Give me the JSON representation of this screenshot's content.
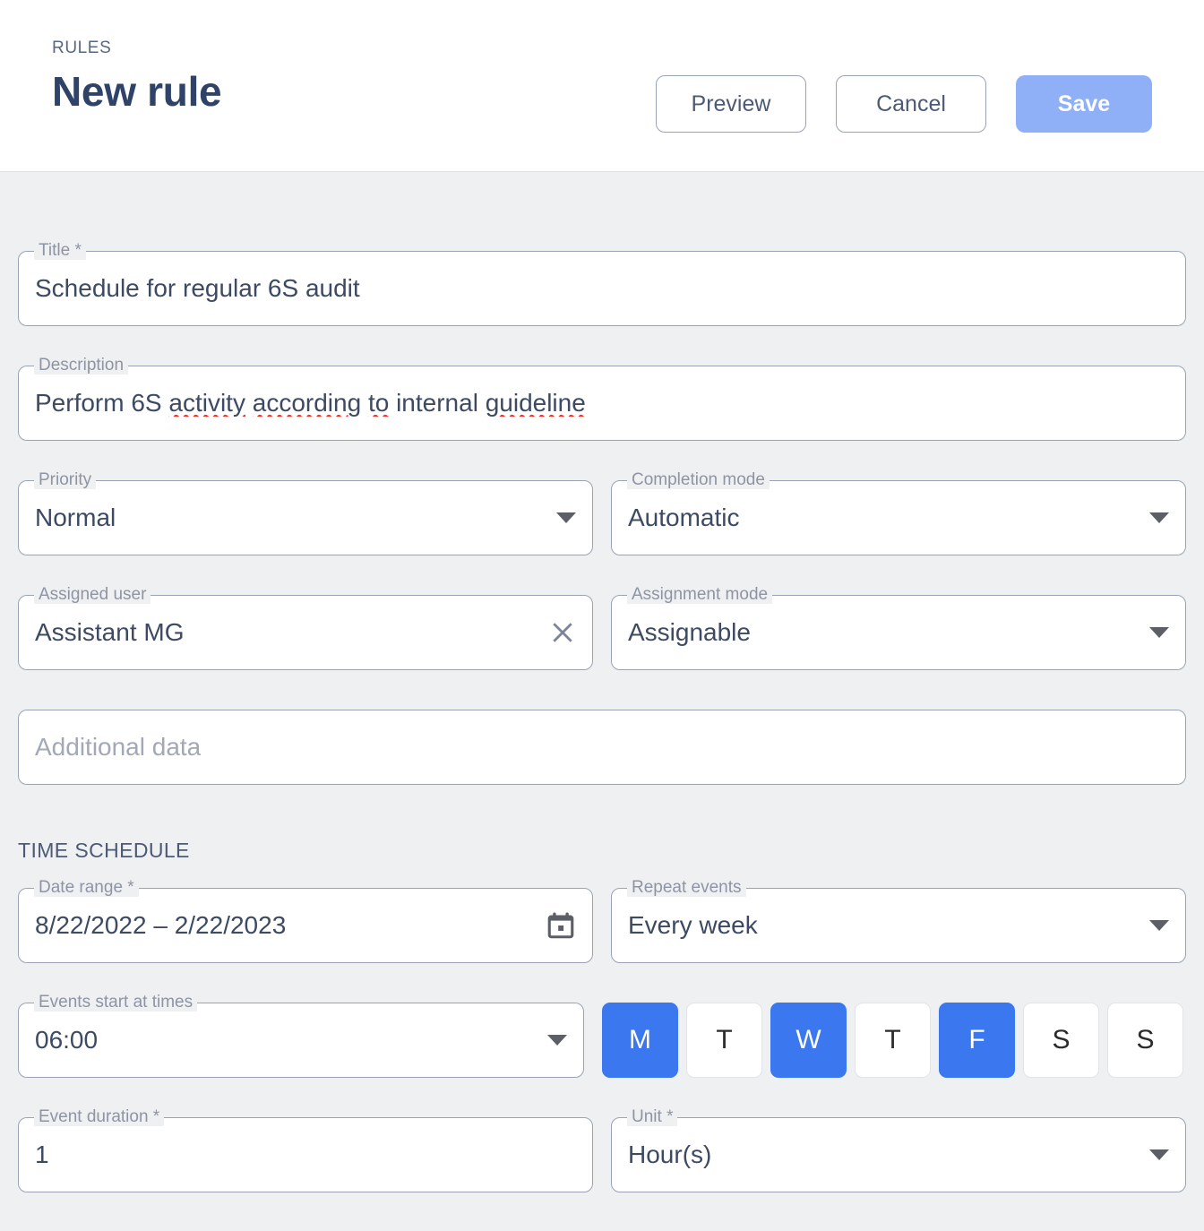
{
  "header": {
    "eyebrow": "RULES",
    "title": "New rule",
    "preview_label": "Preview",
    "cancel_label": "Cancel",
    "save_label": "Save",
    "save_bg": "#8fb0f7"
  },
  "form": {
    "title": {
      "label": "Title *",
      "value": "Schedule for regular 6S audit"
    },
    "description": {
      "label": "Description",
      "value": "Perform 6S activity according to internal guideline",
      "parts": [
        {
          "text": "Perform 6S ",
          "misspelled": false
        },
        {
          "text": "activity",
          "misspelled": true
        },
        {
          "text": " ",
          "misspelled": false
        },
        {
          "text": "according",
          "misspelled": true
        },
        {
          "text": " ",
          "misspelled": false
        },
        {
          "text": "to",
          "misspelled": true
        },
        {
          "text": " internal ",
          "misspelled": false
        },
        {
          "text": "guideline",
          "misspelled": true
        }
      ]
    },
    "priority": {
      "label": "Priority",
      "value": "Normal"
    },
    "completion_mode": {
      "label": "Completion mode",
      "value": "Automatic"
    },
    "assigned_user": {
      "label": "Assigned user",
      "value": "Assistant MG"
    },
    "assignment_mode": {
      "label": "Assignment mode",
      "value": "Assignable"
    },
    "additional_data": {
      "label": "",
      "placeholder": "Additional data",
      "value": ""
    }
  },
  "time_schedule": {
    "section_title": "TIME SCHEDULE",
    "date_range": {
      "label": "Date range *",
      "value": "8/22/2022 – 2/22/2023"
    },
    "repeat_events": {
      "label": "Repeat events",
      "value": "Every week"
    },
    "events_start_at_times": {
      "label": "Events start at times",
      "value": "06:00"
    },
    "event_duration": {
      "label": "Event duration *",
      "value": "1"
    },
    "unit": {
      "label": "Unit *",
      "value": "Hour(s)"
    },
    "selected_color": "#3b78f0",
    "days": [
      {
        "label": "M",
        "selected": true
      },
      {
        "label": "T",
        "selected": false
      },
      {
        "label": "W",
        "selected": true
      },
      {
        "label": "T",
        "selected": false
      },
      {
        "label": "F",
        "selected": true
      },
      {
        "label": "S",
        "selected": false
      },
      {
        "label": "S",
        "selected": false
      }
    ]
  }
}
